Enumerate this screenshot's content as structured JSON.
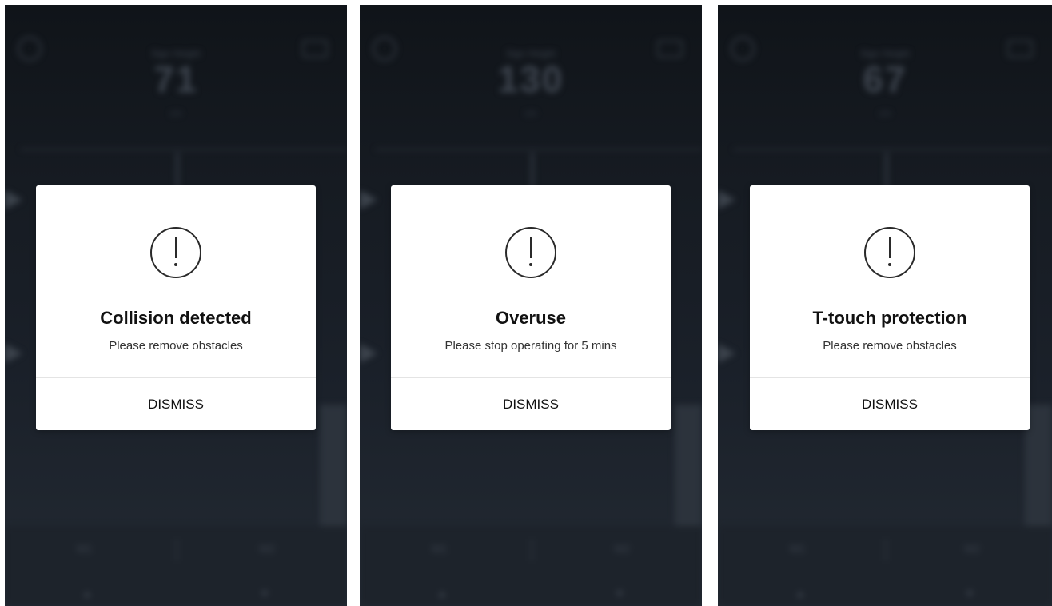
{
  "screens": [
    {
      "background": {
        "small_label": "Sign Height",
        "big_value": "71",
        "unit": "cm",
        "left_btn": "M1",
        "right_btn": "M2"
      },
      "dialog": {
        "icon": "alert-circle-icon",
        "title": "Collision detected",
        "message": "Please remove obstacles",
        "button": "DISMISS"
      }
    },
    {
      "background": {
        "small_label": "Sign Height",
        "big_value": "130",
        "unit": "cm",
        "left_btn": "M1",
        "right_btn": "M2"
      },
      "dialog": {
        "icon": "alert-circle-icon",
        "title": "Overuse",
        "message": "Please stop operating for 5 mins",
        "button": "DISMISS"
      }
    },
    {
      "background": {
        "small_label": "Sign Height",
        "big_value": "67",
        "unit": "cm",
        "left_btn": "M1",
        "right_btn": "M2"
      },
      "dialog": {
        "icon": "alert-circle-icon",
        "title": "T-touch protection",
        "message": "Please remove obstacles",
        "button": "DISMISS"
      }
    }
  ],
  "colors": {
    "dialog_bg": "#ffffff",
    "overlay": "#161b22",
    "text": "#111111"
  }
}
